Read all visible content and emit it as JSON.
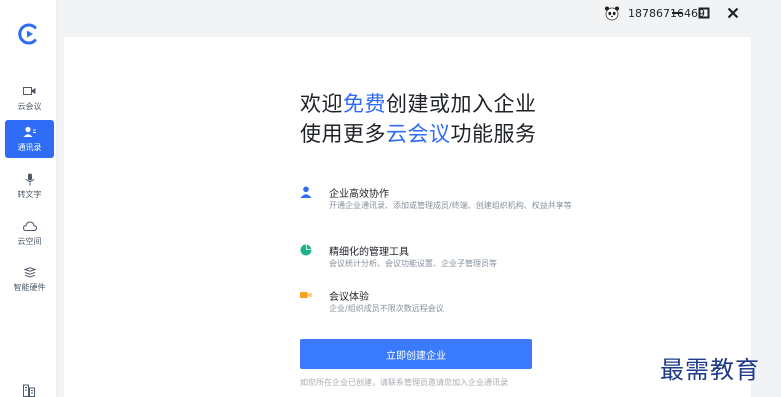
{
  "app": {
    "logo_icon": "app-logo-c"
  },
  "colors": {
    "accent": "#2e6cf6",
    "button": "#3a7afe",
    "pie_green": "#19b48a",
    "video_orange": "#ff9f1c"
  },
  "sidebar": {
    "items": [
      {
        "label": "云会议",
        "icon": "video-icon"
      },
      {
        "label": "通讯录",
        "icon": "contacts-icon",
        "active": true
      },
      {
        "label": "转文字",
        "icon": "microphone-icon"
      },
      {
        "label": "云空间",
        "icon": "cloud-icon"
      },
      {
        "label": "智能硬件",
        "icon": "hardware-stack-icon"
      }
    ],
    "bottom_icon": "building-icon"
  },
  "header": {
    "user_phone": "18786716469",
    "avatar_icon": "panda-avatar",
    "controls": [
      "minimize",
      "maximize",
      "close"
    ]
  },
  "main": {
    "headline1_pre": "欢迎",
    "headline1_hl": "免费",
    "headline1_post": "创建或加入企业",
    "headline2_pre": "使用更多",
    "headline2_hl": "云会议",
    "headline2_post": "功能服务",
    "features": [
      {
        "title": "企业高效协作",
        "desc": "开通企业通讯录、添加或管理成员/终端、创建组织机构、权益共享等",
        "icon": "person-icon"
      },
      {
        "title": "精细化的管理工具",
        "desc": "会议统计分析、会议功能设置、企业子管理员等",
        "icon": "pie-chart-icon"
      },
      {
        "title": "会议体验",
        "desc": "企业/组织成员不限次数远程会议",
        "icon": "video-camera-icon"
      }
    ],
    "cta_label": "立即创建企业",
    "hint": "如您所在企业已创建，请联系管理员邀请您加入企业通讯录"
  },
  "watermark": "最需教育"
}
